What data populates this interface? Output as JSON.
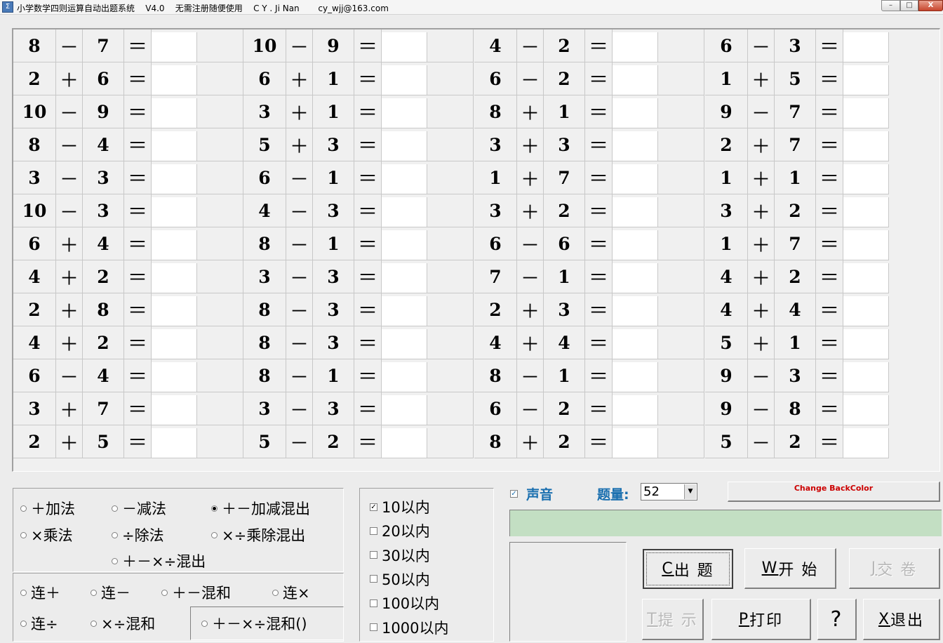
{
  "window": {
    "title": "小学数学四则运算自动出题系统    V4.0    无需注册随便使用    C Y . Ji Nan       cy_wjj@163.com",
    "minimize": "–",
    "maximize": "□",
    "close": "X"
  },
  "equals": "＝",
  "columns": [
    [
      [
        "8",
        "－",
        "7"
      ],
      [
        "2",
        "＋",
        "6"
      ],
      [
        "10",
        "－",
        "9"
      ],
      [
        "8",
        "－",
        "4"
      ],
      [
        "3",
        "－",
        "3"
      ],
      [
        "10",
        "－",
        "3"
      ],
      [
        "6",
        "＋",
        "4"
      ],
      [
        "4",
        "＋",
        "2"
      ],
      [
        "2",
        "＋",
        "8"
      ],
      [
        "4",
        "＋",
        "2"
      ],
      [
        "6",
        "－",
        "4"
      ],
      [
        "3",
        "＋",
        "7"
      ],
      [
        "2",
        "＋",
        "5"
      ]
    ],
    [
      [
        "10",
        "－",
        "9"
      ],
      [
        "6",
        "＋",
        "1"
      ],
      [
        "3",
        "＋",
        "1"
      ],
      [
        "5",
        "＋",
        "3"
      ],
      [
        "6",
        "－",
        "1"
      ],
      [
        "4",
        "－",
        "3"
      ],
      [
        "8",
        "－",
        "1"
      ],
      [
        "3",
        "－",
        "3"
      ],
      [
        "8",
        "－",
        "3"
      ],
      [
        "8",
        "－",
        "3"
      ],
      [
        "8",
        "－",
        "1"
      ],
      [
        "3",
        "－",
        "3"
      ],
      [
        "5",
        "－",
        "2"
      ]
    ],
    [
      [
        "4",
        "－",
        "2"
      ],
      [
        "6",
        "－",
        "2"
      ],
      [
        "8",
        "＋",
        "1"
      ],
      [
        "3",
        "＋",
        "3"
      ],
      [
        "1",
        "＋",
        "7"
      ],
      [
        "3",
        "＋",
        "2"
      ],
      [
        "6",
        "－",
        "6"
      ],
      [
        "7",
        "－",
        "1"
      ],
      [
        "2",
        "＋",
        "3"
      ],
      [
        "4",
        "＋",
        "4"
      ],
      [
        "8",
        "－",
        "1"
      ],
      [
        "6",
        "－",
        "2"
      ],
      [
        "8",
        "＋",
        "2"
      ]
    ],
    [
      [
        "6",
        "－",
        "3"
      ],
      [
        "1",
        "＋",
        "5"
      ],
      [
        "9",
        "－",
        "7"
      ],
      [
        "2",
        "＋",
        "7"
      ],
      [
        "1",
        "＋",
        "1"
      ],
      [
        "3",
        "＋",
        "2"
      ],
      [
        "1",
        "＋",
        "7"
      ],
      [
        "4",
        "＋",
        "2"
      ],
      [
        "4",
        "＋",
        "4"
      ],
      [
        "5",
        "＋",
        "1"
      ],
      [
        "9",
        "－",
        "3"
      ],
      [
        "9",
        "－",
        "8"
      ],
      [
        "5",
        "－",
        "2"
      ]
    ]
  ],
  "operations": {
    "add": "＋加法",
    "sub": "－减法",
    "addsub": "＋－加减混出",
    "mul": "×乘法",
    "div": "÷除法",
    "muldiv": "×÷乘除混出",
    "all": "＋－×÷混出",
    "selected": "addsub"
  },
  "chains": {
    "lian_add": "连＋",
    "lian_sub": "连－",
    "addsub_mix": "＋－混和",
    "lian_mul": "连×",
    "lian_div": "连÷",
    "muldiv_mix": "×÷混和",
    "all_mix": "＋－×÷混和()"
  },
  "ranges": [
    {
      "label": "10以内",
      "checked": true
    },
    {
      "label": "20以内",
      "checked": false
    },
    {
      "label": "30以内",
      "checked": false
    },
    {
      "label": "50以内",
      "checked": false
    },
    {
      "label": "100以内",
      "checked": false
    },
    {
      "label": "1000以内",
      "checked": false
    }
  ],
  "sound": {
    "label": "声音",
    "checked": true
  },
  "quantity": {
    "label": "题量:",
    "value": "52"
  },
  "backcolor_btn": "Change BackColor",
  "status_color": "#c3dfc3",
  "buttons": {
    "generate": {
      "key": "C",
      "label": " 出 题"
    },
    "start": {
      "key": "W",
      "label": " 开 始"
    },
    "submit": {
      "key": "J",
      "label": " 交 卷"
    },
    "hint": {
      "key": "T",
      "label": " 提 示"
    },
    "print": {
      "key": "P",
      "label": " 打印"
    },
    "help": "?",
    "exit": {
      "key": "X",
      "label": " 退出"
    }
  }
}
